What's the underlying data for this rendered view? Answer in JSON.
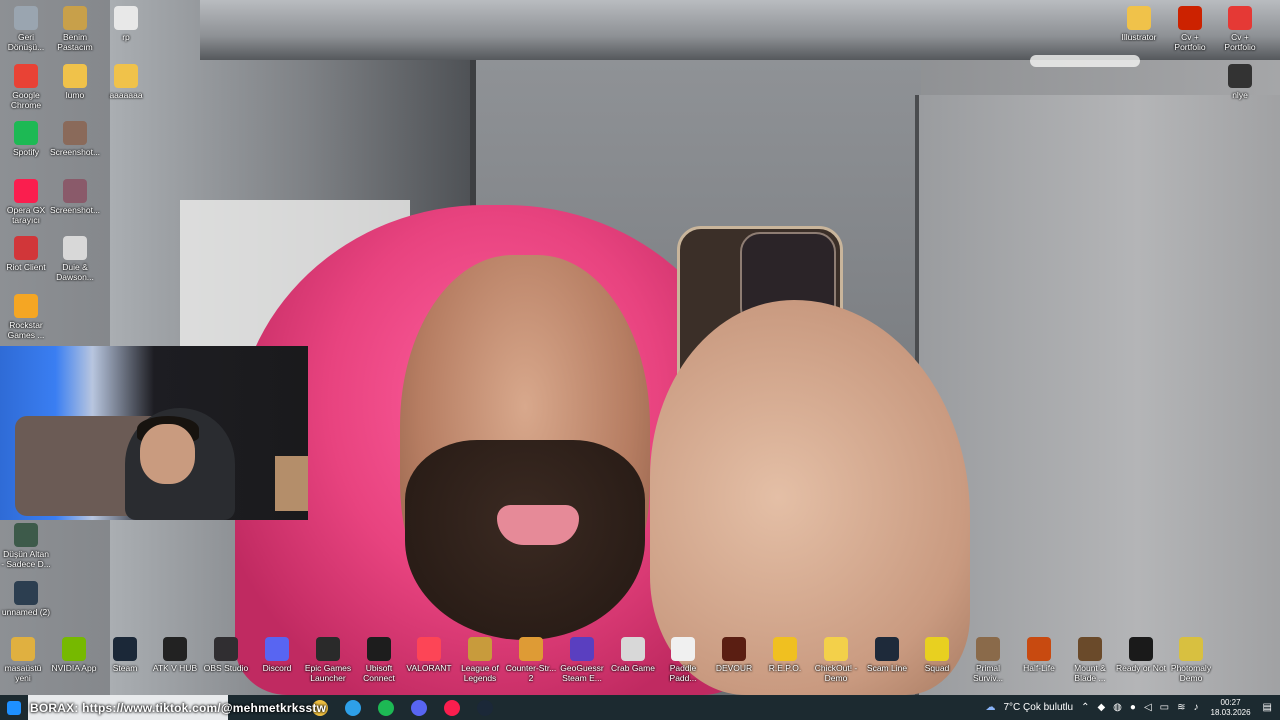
{
  "desktop_icons_left": [
    {
      "label": "Geri\nDönüşü...",
      "icon": "recycle-bin-icon",
      "color": "#9aa5b0"
    },
    {
      "label": "Benim\nPastacım",
      "icon": "folder-image-icon",
      "color": "#c8a04a"
    },
    {
      "label": "rp",
      "icon": "document-icon",
      "color": "#e8e8e8"
    },
    {
      "label": "Google\nChrome",
      "icon": "chrome-icon",
      "color": "#e94235"
    },
    {
      "label": "lumo",
      "icon": "folder-icon",
      "color": "#f0c24a"
    },
    {
      "label": "aaaaaaa",
      "icon": "folder-icon",
      "color": "#f0c24a"
    },
    {
      "label": "Spotify",
      "icon": "spotify-icon",
      "color": "#1db954"
    },
    {
      "label": "Screenshot...",
      "icon": "image-file-icon",
      "color": "#8a6a5a"
    },
    {
      "label": "Opera GX\ntarayıcı",
      "icon": "opera-gx-icon",
      "color": "#fa1e4e"
    },
    {
      "label": "Screenshot...",
      "icon": "image-file-icon",
      "color": "#8a5a6a"
    },
    {
      "label": "Riot Client",
      "icon": "riot-client-icon",
      "color": "#d13639"
    },
    {
      "label": "Duie & Dawson...",
      "icon": "printer-icon",
      "color": "#d8d8d8"
    },
    {
      "label": "Rockstar\nGames ...",
      "icon": "rockstar-icon",
      "color": "#f5a623"
    },
    {
      "label": "Düşün Altan\n- Sadece D...",
      "icon": "video-file-icon",
      "color": "#3d5a4a"
    },
    {
      "label": "unnamed (2)",
      "icon": "image-file-icon",
      "color": "#2c3e50"
    }
  ],
  "desktop_icons_right": [
    {
      "label": "Illustrator",
      "icon": "folder-icon",
      "color": "#f0c24a"
    },
    {
      "label": "Cv +\nPortfolio",
      "icon": "illustrator-file-icon",
      "color": "#cc2200"
    },
    {
      "label": "Cv +\nPortfolio",
      "icon": "pdf-file-icon",
      "color": "#e53935"
    },
    {
      "label": "nlye",
      "icon": "video-file-icon",
      "color": "#333333"
    }
  ],
  "desktop_icons_bottom": [
    {
      "label": "masaüstü\nyeni",
      "icon": "text-file-icon",
      "color": "#e0b040"
    },
    {
      "label": "NVIDIA App",
      "icon": "nvidia-icon",
      "color": "#76b900"
    },
    {
      "label": "Steam",
      "icon": "steam-icon",
      "color": "#1b2838"
    },
    {
      "label": "ATK V HUB",
      "icon": "atk-hub-icon",
      "color": "#222222"
    },
    {
      "label": "OBS Studio",
      "icon": "obs-icon",
      "color": "#302e31"
    },
    {
      "label": "Discord",
      "icon": "discord-icon",
      "color": "#5865f2"
    },
    {
      "label": "Epic Games\nLauncher",
      "icon": "epic-games-icon",
      "color": "#2a2a2a"
    },
    {
      "label": "Ubisoft\nConnect",
      "icon": "ubisoft-icon",
      "color": "#1d1d1d"
    },
    {
      "label": "VALORANT",
      "icon": "valorant-icon",
      "color": "#fd4556"
    },
    {
      "label": "League of\nLegends",
      "icon": "league-icon",
      "color": "#c89b3c"
    },
    {
      "label": "Counter-Str...\n2",
      "icon": "cs2-icon",
      "color": "#de9b35"
    },
    {
      "label": "GeoGuessr\nSteam E...",
      "icon": "geoguessr-icon",
      "color": "#5a3fc0"
    },
    {
      "label": "Crab Game",
      "icon": "crab-game-icon",
      "color": "#d8d8d8"
    },
    {
      "label": "Paddle\nPadd...",
      "icon": "paddle-icon",
      "color": "#f0f0f0"
    },
    {
      "label": "DEVOUR",
      "icon": "devour-icon",
      "color": "#5a1e12"
    },
    {
      "label": "R.E.P.O.",
      "icon": "repo-icon",
      "color": "#f0c020"
    },
    {
      "label": "ChickOut! -\nDemo",
      "icon": "chickout-icon",
      "color": "#f3d04a"
    },
    {
      "label": "Scam Line",
      "icon": "scam-line-icon",
      "color": "#1e2a3a"
    },
    {
      "label": "Squad",
      "icon": "squad-icon",
      "color": "#e8d020"
    },
    {
      "label": "Primal\nSurviv...",
      "icon": "primal-survival-icon",
      "color": "#8a6a4a"
    },
    {
      "label": "Half-Life",
      "icon": "half-life-icon",
      "color": "#c84a10"
    },
    {
      "label": "Mount &\nBlade ...",
      "icon": "mount-blade-icon",
      "color": "#6a4a2a"
    },
    {
      "label": "Ready or Not",
      "icon": "ready-or-not-icon",
      "color": "#1a1a1a"
    },
    {
      "label": "Photomaly\nDemo",
      "icon": "photomaly-icon",
      "color": "#d8c040"
    }
  ],
  "overlay_text": "BORAX: https://www.tiktok.com/@mehmetkrksstw",
  "taskbar": {
    "search_value": "",
    "apps": [
      {
        "name": "file-explorer-icon",
        "color": "#f0c040"
      },
      {
        "name": "edge-icon",
        "color": "#2ea0e8"
      },
      {
        "name": "spotify-taskbar-icon",
        "color": "#1db954"
      },
      {
        "name": "discord-taskbar-icon",
        "color": "#5865f2"
      },
      {
        "name": "opera-gx-taskbar-icon",
        "color": "#fa1e4e"
      },
      {
        "name": "steam-taskbar-icon",
        "color": "#1b2838"
      }
    ],
    "weather": "7°C  Çok bulutlu",
    "time": "00:27",
    "date": "18.03.2026"
  }
}
